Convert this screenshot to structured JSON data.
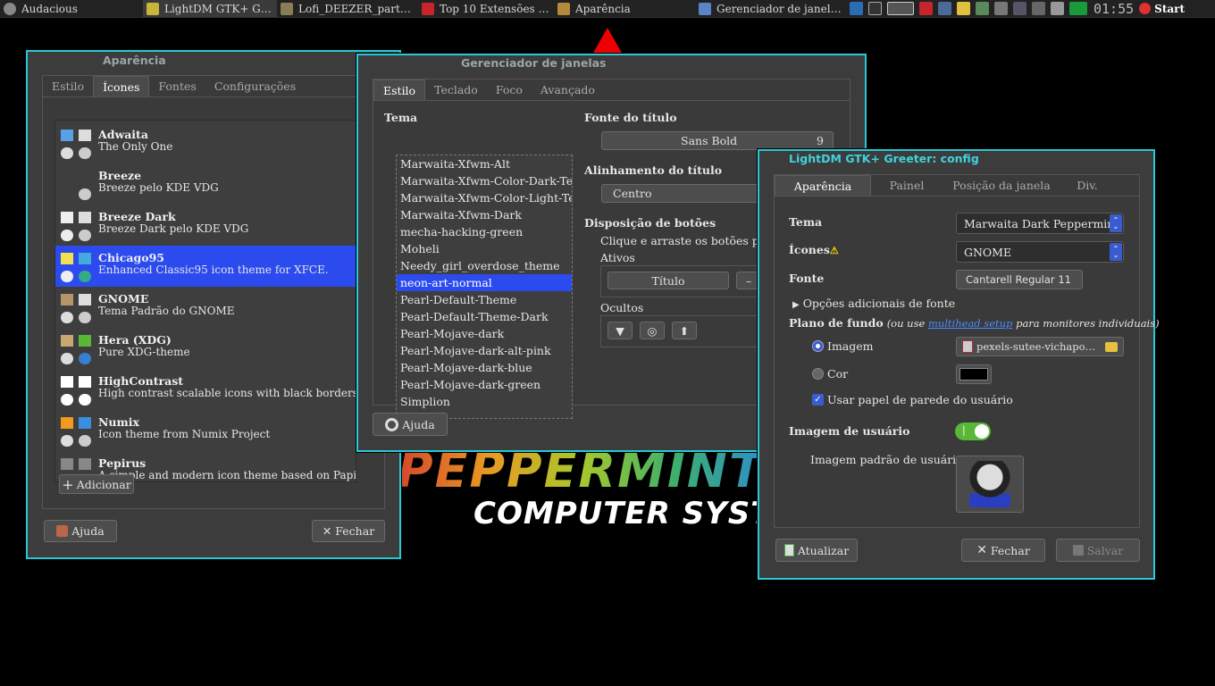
{
  "taskbar": {
    "tasks": [
      {
        "label": "Audacious",
        "icon": "audacious-icon",
        "color": "#888888"
      },
      {
        "label": "LightDM GTK+ Gree…",
        "icon": "lightdm-icon",
        "color": "#c9b53a"
      },
      {
        "label": "Lofi_DEEZER_part…",
        "icon": "folder-icon",
        "color": "#8a7d55"
      },
      {
        "label": "Top 10 Extensões G…",
        "icon": "vivaldi-icon",
        "color": "#c8242b"
      },
      {
        "label": "Aparência",
        "icon": "appearance-icon",
        "color": "#b58a3a"
      },
      {
        "label": "Gerenciador de janel…",
        "icon": "window-manager-icon",
        "color": "#5a84c8"
      }
    ],
    "clock": "01:55",
    "start_label": "Start"
  },
  "wallpaper": {
    "brand": "PEPPERMINT",
    "subtitle": "COMPUTER SYSTE"
  },
  "appearance": {
    "title": "Aparência",
    "tabs": [
      "Estilo",
      "Ícones",
      "Fontes",
      "Configurações"
    ],
    "selected_tab": "Ícones",
    "icon_themes": [
      {
        "name": "Adwaita",
        "desc": "The Only One"
      },
      {
        "name": "Breeze",
        "desc": "Breeze pelo KDE VDG"
      },
      {
        "name": "Breeze Dark",
        "desc": "Breeze Dark pelo KDE VDG"
      },
      {
        "name": "Chicago95",
        "desc": "Enhanced Classic95 icon theme for XFCE."
      },
      {
        "name": "GNOME",
        "desc": "Tema Padrão do GNOME"
      },
      {
        "name": "Hera (XDG)",
        "desc": "Pure XDG-theme"
      },
      {
        "name": "HighContrast",
        "desc": "High contrast scalable icons with black borders"
      },
      {
        "name": "Numix",
        "desc": "Icon theme from Numix Project"
      },
      {
        "name": "Pepirus",
        "desc": "A simple and modern icon theme based on Papirus."
      }
    ],
    "selected_theme": "Chicago95",
    "add_label": "Adicionar",
    "help_label": "Ajuda",
    "close_label": "Fechar"
  },
  "wm": {
    "title": "Gerenciador de janelas",
    "tabs": [
      "Estilo",
      "Teclado",
      "Foco",
      "Avançado"
    ],
    "theme_heading": "Tema",
    "themes": [
      "Marwaita-Xfwm-Alt",
      "Marwaita-Xfwm-Color-Dark-Text",
      "Marwaita-Xfwm-Color-Light-Text",
      "Marwaita-Xfwm-Dark",
      "mecha-hacking-green",
      "Moheli",
      "Needy_girl_overdose_theme",
      "neon-art-normal",
      "Pearl-Default-Theme",
      "Pearl-Default-Theme-Dark",
      "Pearl-Mojave-dark",
      "Pearl-Mojave-dark-alt-pink",
      "Pearl-Mojave-dark-blue",
      "Pearl-Mojave-dark-green",
      "Simplion"
    ],
    "selected_theme": "neon-art-normal",
    "title_font_heading": "Fonte do título",
    "title_font": "Sans Bold",
    "title_font_size": "9",
    "title_align_heading": "Alinhamento do título",
    "title_align": "Centro",
    "buttons_heading": "Disposição de botões",
    "buttons_hint": "Clique e arraste os botões para",
    "active_label": "Ativos",
    "title_button": "Título",
    "hidden_label": "Ocultos",
    "help_label": "Ajuda"
  },
  "greeter": {
    "title": "LightDM GTK+ Greeter: config",
    "tabs": [
      "Aparência",
      "Painel",
      "Posição da janela",
      "Div."
    ],
    "theme_label": "Tema",
    "theme_value": "Marwaita Dark Peppermint",
    "icons_label": "Ícones",
    "icons_value": "GNOME",
    "font_label": "Fonte",
    "font_value": "Cantarell Regular",
    "font_size": "11",
    "font_options": "Opções adicionais de fonte",
    "background_label": "Plano de fundo",
    "background_hint_pre": "(ou use ",
    "background_hint_link": "multihead setup",
    "background_hint_post": " para monitores individuais)",
    "image_label": "Imagem",
    "image_file": "pexels-sutee-vichapo…",
    "color_label": "Cor",
    "wallpaper_check": "Usar papel de parede do usuário",
    "user_image_label": "Imagem de usuário",
    "user_image_on": true,
    "default_user_image": "Imagem padrão de usuário",
    "refresh_label": "Atualizar",
    "close_label": "Fechar",
    "save_label": "Salvar"
  }
}
